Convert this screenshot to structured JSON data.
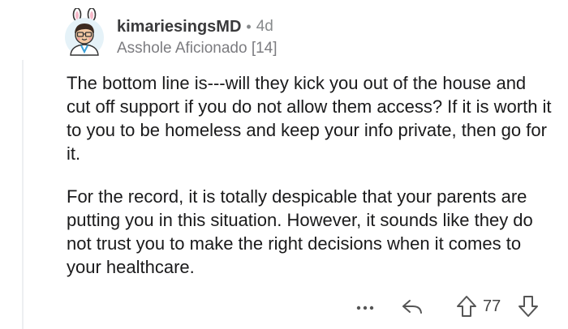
{
  "comment": {
    "author": "kimariesingsMD",
    "separator": "•",
    "age": "4d",
    "flair": "Asshole Aficionado [14]",
    "paragraphs": [
      "The bottom line is---will they kick you out of the house and cut off support if you do not allow them access? If it is worth it to you to be homeless and keep your info private, then go for it.",
      "For the record, it is totally despicable that your parents are putting you in this situation. However, it sounds like they do not trust you to make the right decisions when it comes to your healthcare."
    ]
  },
  "actions": {
    "more_icon": "more-dots-icon",
    "reply_icon": "reply-arrow-icon",
    "upvote_icon": "upvote-arrow-icon",
    "downvote_icon": "downvote-arrow-icon",
    "vote_count": "77"
  },
  "colors": {
    "text": "#1a1a1b",
    "meta": "#878a8c",
    "avatar_bg": "#e5f2f8",
    "thread_line": "#edeff1"
  }
}
